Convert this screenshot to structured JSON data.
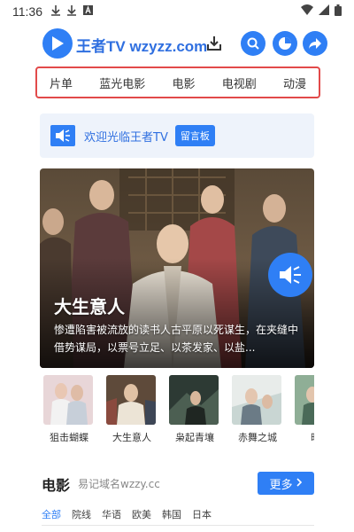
{
  "status_bar": {
    "time": "11:36",
    "icons": [
      "download-icon",
      "download-icon",
      "a-icon"
    ],
    "right_icons": [
      "wifi-icon",
      "signal-icon",
      "battery-icon"
    ]
  },
  "header": {
    "brand": "王者TV wzyzz.com"
  },
  "nav": {
    "items": [
      "片单",
      "蓝光电影",
      "电影",
      "电视剧",
      "动漫"
    ]
  },
  "welcome": {
    "text": "欢迎光临王者TV",
    "button": "留言板"
  },
  "hero": {
    "title": "大生意人",
    "description": "惨遭陷害被流放的读书人古平原以死谋生，在夹缝中借势谋局，以票号立足、以茶发家、以盐..."
  },
  "thumbnails": [
    {
      "label": "狙击蝴蝶"
    },
    {
      "label": "大生意人"
    },
    {
      "label": "枭起青壤"
    },
    {
      "label": "赤舞之城"
    },
    {
      "label": "时差"
    }
  ],
  "movie_section": {
    "title": "电影",
    "subtitle": "易记域名wzzy.cc",
    "more": "更多",
    "filters": [
      "全部",
      "院线",
      "华语",
      "欧美",
      "韩国",
      "日本"
    ]
  },
  "colors": {
    "accent": "#2f7ff5",
    "nav_border": "#e24a4a"
  }
}
